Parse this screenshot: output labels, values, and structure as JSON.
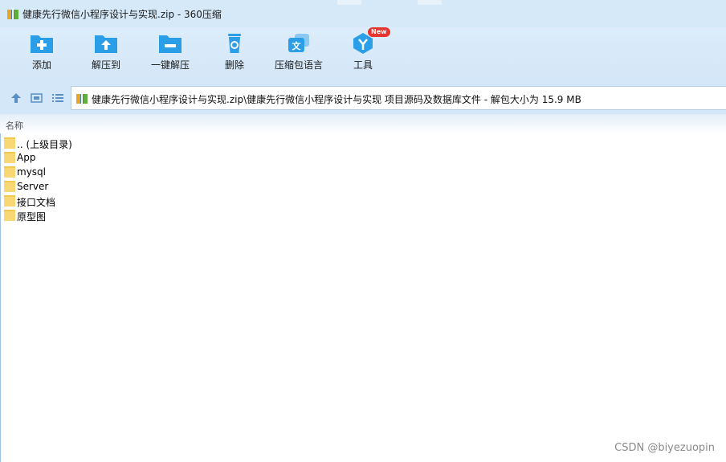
{
  "window": {
    "title": "健康先行微信小程序设计与实现.zip - 360压缩"
  },
  "toolbar": {
    "items": [
      {
        "label": "添加",
        "icon": "folder-add-icon"
      },
      {
        "label": "解压到",
        "icon": "folder-extract-icon"
      },
      {
        "label": "一键解压",
        "icon": "folder-quick-extract-icon"
      },
      {
        "label": "删除",
        "icon": "trash-icon"
      },
      {
        "label": "压缩包语言",
        "icon": "language-icon"
      },
      {
        "label": "工具",
        "icon": "tools-icon",
        "badge": "New"
      }
    ]
  },
  "navbar": {
    "path": "健康先行微信小程序设计与实现.zip\\健康先行微信小程序设计与实现 项目源码及数据库文件 - 解包大小为 15.9 MB"
  },
  "list": {
    "column_name": "名称",
    "items": [
      {
        "label": ".. (上级目录)"
      },
      {
        "label": "App"
      },
      {
        "label": "mysql"
      },
      {
        "label": "Server"
      },
      {
        "label": "接口文档"
      },
      {
        "label": "原型图"
      }
    ]
  },
  "watermark": "CSDN @biyezuopin",
  "colors": {
    "accent": "#2a9fe8",
    "folder": "#f8d775",
    "badge": "#e5352e"
  }
}
